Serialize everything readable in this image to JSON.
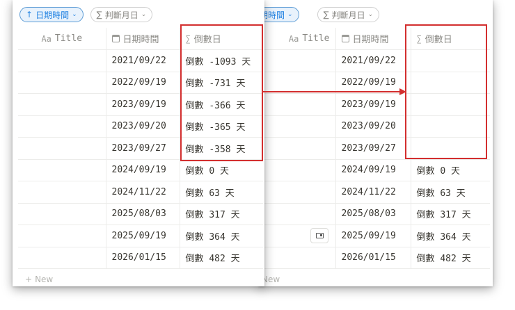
{
  "toolbar": {
    "sort_label": "日期時間",
    "filter_label": "判斷月日"
  },
  "columns": {
    "title": "Title",
    "title_prefix": "Aa",
    "date": "日期時間",
    "countdown": "倒數日"
  },
  "rows_before": [
    {
      "date": "2021/09/22",
      "countdown": "倒數 -1093 天"
    },
    {
      "date": "2022/09/19",
      "countdown": "倒數 -731 天"
    },
    {
      "date": "2023/09/19",
      "countdown": "倒數 -366 天"
    },
    {
      "date": "2023/09/20",
      "countdown": "倒數 -365 天"
    },
    {
      "date": "2023/09/27",
      "countdown": "倒數 -358 天"
    },
    {
      "date": "2024/09/19",
      "countdown": "倒數 0 天"
    },
    {
      "date": "2024/11/22",
      "countdown": "倒數 63 天"
    },
    {
      "date": "2025/08/03",
      "countdown": "倒數 317 天"
    },
    {
      "date": "2025/09/19",
      "countdown": "倒數 364 天"
    },
    {
      "date": "2026/01/15",
      "countdown": "倒數 482 天"
    }
  ],
  "rows_after": [
    {
      "date": "2021/09/22",
      "countdown": ""
    },
    {
      "date": "2022/09/19",
      "countdown": ""
    },
    {
      "date": "2023/09/19",
      "countdown": ""
    },
    {
      "date": "2023/09/20",
      "countdown": ""
    },
    {
      "date": "2023/09/27",
      "countdown": ""
    },
    {
      "date": "2024/09/19",
      "countdown": "倒數 0 天"
    },
    {
      "date": "2024/11/22",
      "countdown": "倒數 63 天"
    },
    {
      "date": "2025/08/03",
      "countdown": "倒數 317 天"
    },
    {
      "date": "2025/09/19",
      "countdown": "倒數 364 天"
    },
    {
      "date": "2026/01/15",
      "countdown": "倒數 482 天"
    }
  ],
  "new_row_label": "New",
  "colors": {
    "accent_blue": "#2383e2",
    "highlight_red": "#d32f2f"
  }
}
